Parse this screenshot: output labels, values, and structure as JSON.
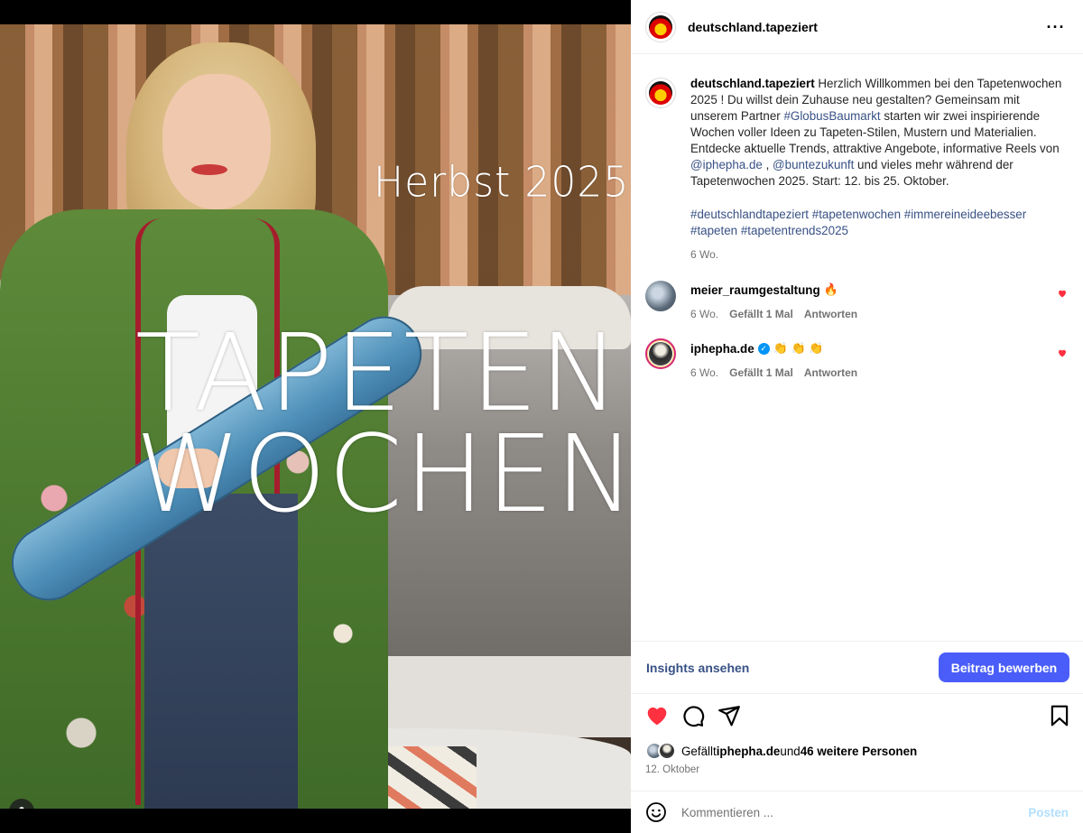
{
  "post": {
    "media": {
      "overlay_small": "Herbst 2025",
      "overlay_line1": "TAPETEN",
      "overlay_line2": "WOCHEN",
      "user_tag_icon": "person-icon"
    },
    "header": {
      "username": "deutschland.tapeziert",
      "more_icon": "more-options-icon",
      "more_label": "···"
    },
    "caption": {
      "username": "deutschland.tapeziert",
      "text_1": " Herzlich Willkommen bei den Tapetenwochen 2025 ! Du willst dein Zuhause neu gestalten? Gemeinsam mit unserem Partner ",
      "mention_globus": "#GlobusBaumarkt",
      "text_2": " starten wir zwei inspirierende Wochen voller Ideen zu Tapeten-Stilen, Mustern und Materialien. Entdecke aktuelle Trends, attraktive Angebote, informative Reels von ",
      "mention_iphepha": "@iphepha.de",
      "text_3": " , ",
      "mention_buntezukunft": "@buntezukunft",
      "text_4": " und vieles mehr während der Tapetenwochen 2025. Start: 12. bis 25. Oktober.",
      "hashtags_line1": "#deutschlandtapeziert #tapetenwochen #immereineideebesser",
      "hashtags_line2": "#tapeten #tapetentrends2025",
      "time_ago": "6 Wo."
    },
    "comments": [
      {
        "username": "meier_raumgestaltung",
        "text": "🔥",
        "time": "6 Wo.",
        "likes": "Gefällt 1 Mal",
        "reply": "Antworten"
      },
      {
        "username": "iphepha.de",
        "verified_mark": "✓",
        "text": "👏 👏 👏",
        "time": "6 Wo.",
        "likes": "Gefällt 1 Mal",
        "reply": "Antworten"
      }
    ],
    "insights_label": "Insights ansehen",
    "promote_label": "Beitrag bewerben",
    "likes": {
      "prefix": "Gefällt ",
      "user": "iphepha.de",
      "middle": " und ",
      "count": "46 weitere Personen"
    },
    "date": "12. Oktober",
    "comment_box": {
      "placeholder": "Kommentieren ...",
      "post_label": "Posten"
    }
  },
  "colors": {
    "accent": "#4a5df9",
    "link": "#385185",
    "like_red": "#ff3040",
    "muted": "#737373"
  }
}
